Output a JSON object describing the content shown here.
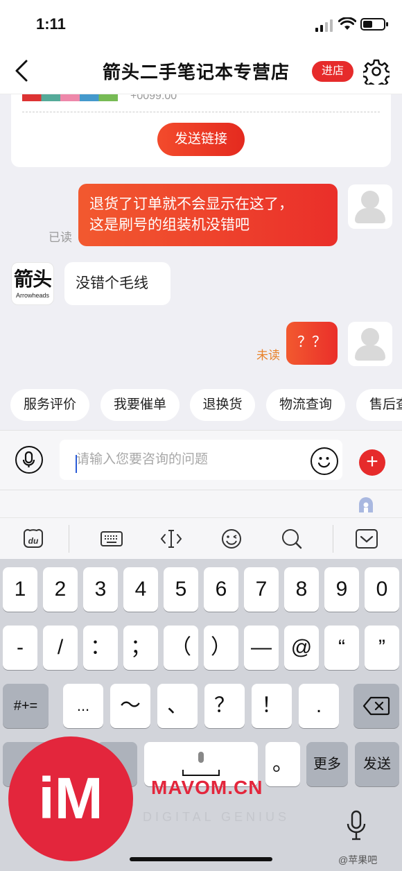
{
  "status_bar": {
    "time": "1:11"
  },
  "header": {
    "title": "箭头二手笔记本专营店",
    "shop_button": "进店"
  },
  "product_card": {
    "price": "+0099.00",
    "send_link_label": "发送链接"
  },
  "messages": [
    {
      "from": "user",
      "text_lines": [
        "退货了订单就不会显示在这了，",
        "这是刷号的组装机没错吧"
      ],
      "status": "已读"
    },
    {
      "from": "shop",
      "text": "没错个毛线",
      "shop_logo": "箭头",
      "shop_logo_sub": "Arrowheads"
    },
    {
      "from": "user",
      "text": "？？",
      "status": "未读"
    }
  ],
  "quick_actions": [
    "服务评价",
    "我要催单",
    "退换货",
    "物流查询",
    "售后查询"
  ],
  "input": {
    "placeholder": "请输入您要咨询的问题"
  },
  "keyboard": {
    "row1": [
      "1",
      "2",
      "3",
      "4",
      "5",
      "6",
      "7",
      "8",
      "9",
      "0"
    ],
    "row2": [
      "-",
      "/",
      "：",
      "；",
      "（",
      "）",
      "—",
      "@",
      "“",
      "”"
    ],
    "row3": [
      "#+=",
      "...",
      "～",
      "、",
      "？",
      "！",
      "."
    ],
    "space_label": "",
    "period": "。",
    "more_label": "更多",
    "send_label": "发送"
  },
  "watermark": {
    "badge": "iM",
    "brand": "MAVOM.CN",
    "tagline": "DIGITAL GENIUS",
    "site": "@苹果吧"
  },
  "colors": {
    "accent": "#e62b2b",
    "bubble_out": "#ef4130",
    "unread": "#e8822a",
    "read": "#9a9a9a"
  }
}
